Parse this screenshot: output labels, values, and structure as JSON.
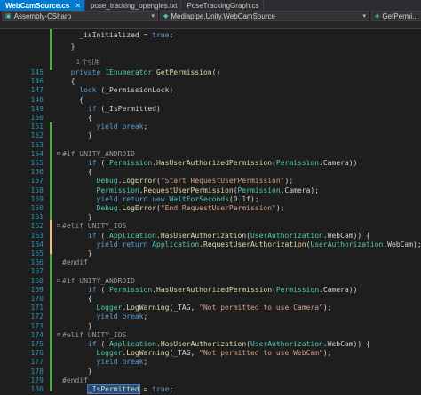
{
  "tabs": [
    {
      "label": "WebCamSource.cs",
      "active": true
    },
    {
      "label": "pose_tracking_opengles.txt",
      "active": false
    },
    {
      "label": "PoseTrackingGraph.cs",
      "active": false
    }
  ],
  "nav": {
    "project": "Assembly-CSharp",
    "class": "Mediapipe.Unity.WebCamSource",
    "member": "GetPermi..."
  },
  "code_lines": [
    {
      "n": "",
      "html": "    _isInitialized = true;"
    },
    {
      "n": "",
      "html": "  }"
    },
    {
      "n": "",
      "html": ""
    },
    {
      "n": "145",
      "html": "  private IEnumerator GetPermission()"
    },
    {
      "n": "146",
      "html": "  {"
    },
    {
      "n": "147",
      "html": "    lock (_PermissionLock)"
    },
    {
      "n": "148",
      "html": "    {"
    },
    {
      "n": "149",
      "html": "      if (_IsPermitted)"
    },
    {
      "n": "150",
      "html": "      {"
    },
    {
      "n": "151",
      "html": "        yield break;"
    },
    {
      "n": "152",
      "html": "      }"
    },
    {
      "n": "153",
      "html": ""
    },
    {
      "n": "154",
      "html": "#if UNITY_ANDROID"
    },
    {
      "n": "155",
      "html": "      if (!Permission.HasUserAuthorizedPermission(Permission.Camera))"
    },
    {
      "n": "156",
      "html": "      {"
    },
    {
      "n": "157",
      "html": "        Debug.LogError(\"Start RequestUserPermission\");"
    },
    {
      "n": "158",
      "html": "        Permission.RequestUserPermission(Permission.Camera);"
    },
    {
      "n": "159",
      "html": "        yield return new WaitForSeconds(0.1f);"
    },
    {
      "n": "160",
      "html": "        Debug.LogError(\"End RequestUserPermission\");"
    },
    {
      "n": "161",
      "html": "      }"
    },
    {
      "n": "162",
      "html": "#elif UNITY_IOS"
    },
    {
      "n": "163",
      "html": "      if (!Application.HasUserAuthorization(UserAuthorization.WebCam)) {"
    },
    {
      "n": "164",
      "html": "        yield return Application.RequestUserAuthorization(UserAuthorization.WebCam);"
    },
    {
      "n": "165",
      "html": "      }"
    },
    {
      "n": "166",
      "html": "#endif"
    },
    {
      "n": "167",
      "html": ""
    },
    {
      "n": "168",
      "html": "#if UNITY_ANDROID"
    },
    {
      "n": "169",
      "html": "      if (!Permission.HasUserAuthorizedPermission(Permission.Camera))"
    },
    {
      "n": "170",
      "html": "      {"
    },
    {
      "n": "171",
      "html": "        Logger.LogWarning(_TAG, \"Not permitted to use Camera\");"
    },
    {
      "n": "172",
      "html": "        yield break;"
    },
    {
      "n": "173",
      "html": "      }"
    },
    {
      "n": "174",
      "html": "#elif UNITY_IOS"
    },
    {
      "n": "175",
      "html": "      if (!Application.HasUserAuthorization(UserAuthorization.WebCam)) {"
    },
    {
      "n": "176",
      "html": "        Logger.LogWarning(_TAG, \"Not permitted to use WebCam\");"
    },
    {
      "n": "177",
      "html": "        yield break;"
    },
    {
      "n": "178",
      "html": "      }"
    },
    {
      "n": "179",
      "html": "#endif"
    },
    {
      "n": "180",
      "html": "      _IsPermitted = true;"
    }
  ],
  "reference_hint": "1 个引用",
  "colors": {
    "accent": "#007acc",
    "bg": "#1e1e1e",
    "linenum": "#2b91af"
  }
}
